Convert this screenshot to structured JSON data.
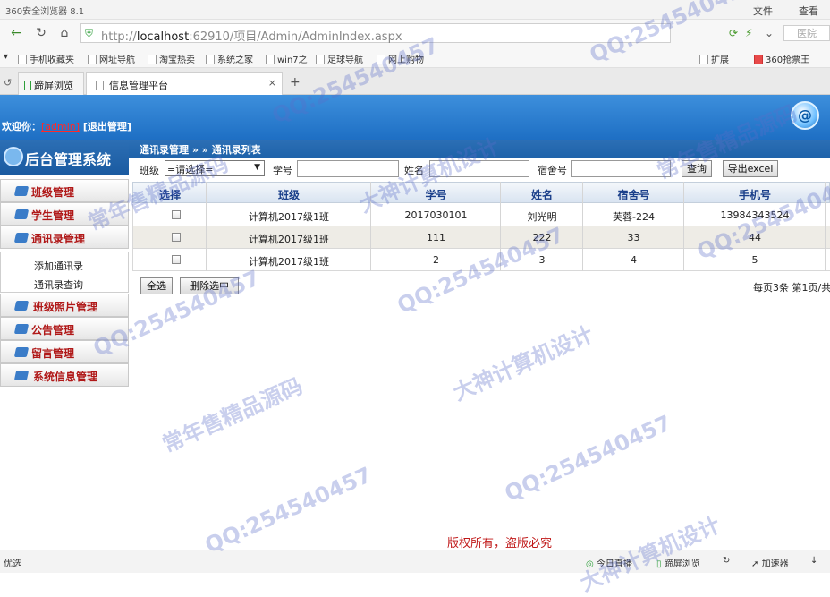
{
  "browser": {
    "title": "360安全浏览器 8.1",
    "menu_file": "文件",
    "menu_view": "查看",
    "url_host": "localhost",
    "url_rest": ":62910/项目/Admin/AdminIndex.aspx",
    "url_prefix": "http://",
    "search_placeholder": "医院",
    "bookmarks": [
      "手机收藏夹",
      "网址导航",
      "淘宝热卖",
      "系统之家",
      "win7之",
      "足球导航",
      "网上购物"
    ],
    "ext": "扩展",
    "grab": "360抢票王",
    "tabs": [
      "蹄屏浏览",
      "信息管理平台"
    ],
    "new_tab": "+"
  },
  "header": {
    "welcome": "欢迎你：",
    "user": "[admin]",
    "logout": "[退出管理]",
    "system_title": "后台管理系统"
  },
  "sidebar": {
    "items": [
      "班级管理",
      "学生管理",
      "通讯录管理",
      "班级照片管理",
      "公告管理",
      "留言管理",
      "系统信息管理"
    ],
    "sub_items": [
      "添加通讯录",
      "通讯录查询"
    ]
  },
  "breadcrumb": "通讯录管理 » » 通讯录列表",
  "filter": {
    "class_label": "班级",
    "class_select": "=请选择=",
    "student_no_label": "学号",
    "name_label": "姓名",
    "dorm_label": "宿舍号",
    "search_btn": "查询",
    "export_btn": "导出excel"
  },
  "table": {
    "headers": [
      "选择",
      "班级",
      "学号",
      "姓名",
      "宿舍号",
      "手机号"
    ],
    "rows": [
      [
        "",
        "计算机2017级1班",
        "2017030101",
        "刘光明",
        "芙蓉-224",
        "13984343524"
      ],
      [
        "",
        "计算机2017级1班",
        "111",
        "222",
        "33",
        "44"
      ],
      [
        "",
        "计算机2017级1班",
        "2",
        "3",
        "4",
        "5"
      ]
    ]
  },
  "actions": {
    "select_all": "全选",
    "delete_selected": "删除选中",
    "pager": "每页3条 第1页/共"
  },
  "footer": "版权所有，盗版必究",
  "statusbar": {
    "left": "优选",
    "live": "今日直播",
    "split": "蹄屏浏览",
    "accel": "加速器"
  },
  "watermarks": {
    "qq": "QQ:254540457",
    "shop": "常年售精品源码",
    "design": "大神计算机设计"
  },
  "colors": {
    "header_blue": "#1e6fc4",
    "sidebar_text_red": "#b01818",
    "footer_red": "#c01818",
    "watermark": "#5a6ec8"
  }
}
